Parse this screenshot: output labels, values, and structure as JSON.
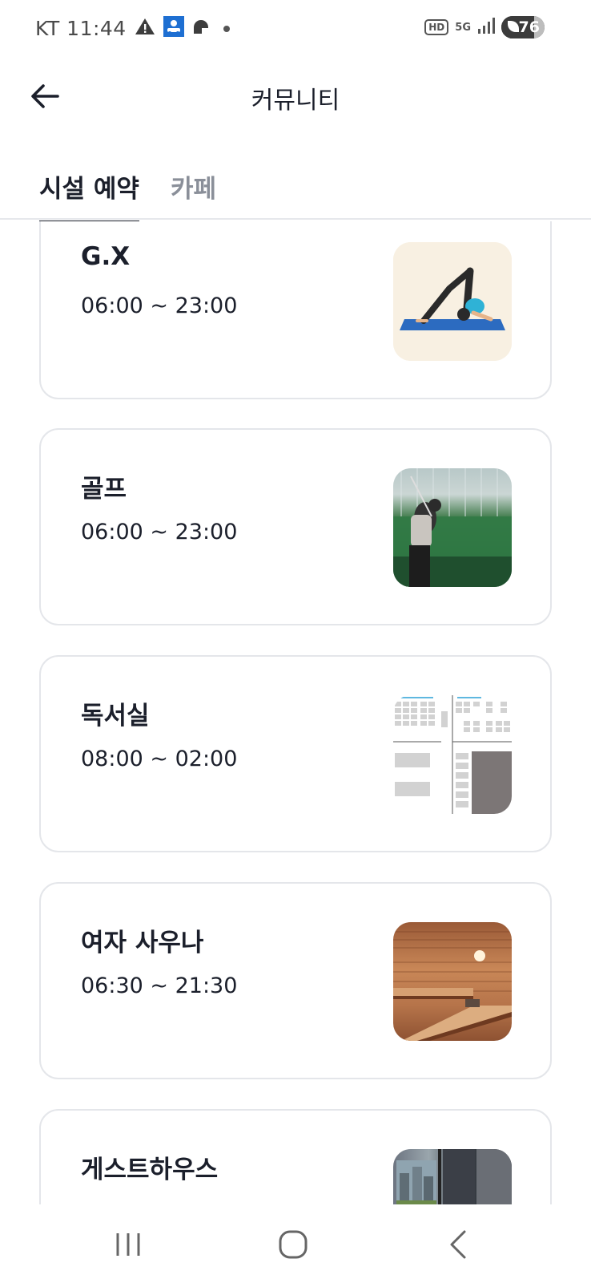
{
  "status_bar": {
    "carrier_time": "KT 11:44",
    "hd": "HD",
    "network": "5G",
    "battery": "76"
  },
  "header": {
    "title": "커뮤니티",
    "back_icon": "arrow-left-icon"
  },
  "tabs": [
    {
      "label": "시설 예약",
      "active": true
    },
    {
      "label": "카페",
      "active": false
    }
  ],
  "facilities": [
    {
      "name": "G.X",
      "hours": "06:00 ~ 23:00",
      "image": "yoga-pose-illustration"
    },
    {
      "name": "골프",
      "hours": "06:00 ~ 23:00",
      "image": "golf-driving-range-photo"
    },
    {
      "name": "독서실",
      "hours": "08:00 ~ 02:00",
      "image": "study-room-seat-map"
    },
    {
      "name": "여자 사우나",
      "hours": "06:30 ~ 21:30",
      "image": "sauna-room-photo"
    },
    {
      "name": "게스트하우스",
      "hours": "",
      "image": "guesthouse-room-photo"
    }
  ],
  "colors": {
    "text_primary": "#1b1f2b",
    "text_inactive": "#8a8f99",
    "card_border": "#e4e6ea"
  }
}
